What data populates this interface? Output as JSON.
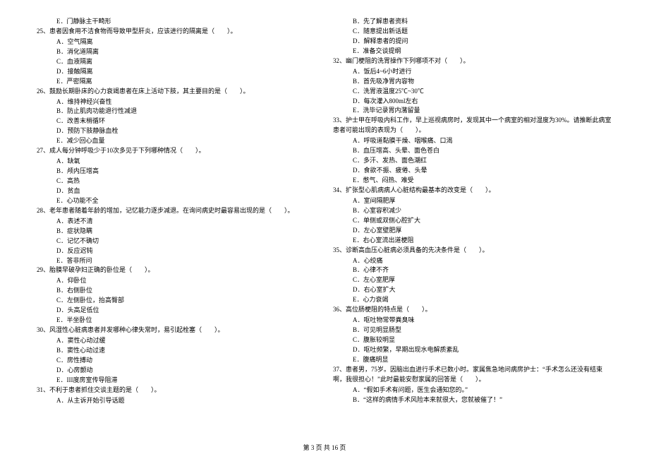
{
  "footer": "第 3 页 共 16 页",
  "left": {
    "preE": "E．门静脉主干畸形",
    "q25": {
      "stem": "25、患者因食用不洁食物而导致甲型肝炎，应该进行的隔离是（　　）。",
      "A": "A．空气隔离",
      "B": "B．消化道隔离",
      "C": "C．血液隔离",
      "D": "D．接触隔离",
      "E": "E．严密隔离"
    },
    "q26": {
      "stem": "26、鼓励长期卧床的心力衰竭患者在床上活动下肢，其主要目的是（　　）。",
      "A": "A．维持神经兴奋性",
      "B": "B．防止肌肉功能退行性减退",
      "C": "C．改善末梢循环",
      "D": "D．预防下肢静脉血栓",
      "E": "E．减少回心血量"
    },
    "q27": {
      "stem": "27、成人每分钟呼吸少于10次多见于下列哪种情况（　　）。",
      "A": "A．缺氧",
      "B": "B．颅内压增高",
      "C": "C．高热",
      "D": "D．贫血",
      "E": "E．心功能不全"
    },
    "q28": {
      "stem": "28、老年患者随着年龄的增加，记忆能力逐步减退。在询问病史时最容易出现的是（　　）。",
      "A": "A．表述不清",
      "B": "B．症状隐瞒",
      "C": "C．记忆不确切",
      "D": "D．反应迟钝",
      "E": "E．答非所问"
    },
    "q29": {
      "stem": "29、胎膜早破孕妇正确的卧位是（　　）。",
      "A": "A．仰卧位",
      "B": "B．右侧卧位",
      "C": "C．左侧卧位，抬高臀部",
      "D": "D．头高足低位",
      "E": "E．半坐卧位"
    },
    "q30": {
      "stem": "30、风湿性心脏病患者并发哪种心律失常时，易引起栓塞（　　）。",
      "A": "A．窦性心动过缓",
      "B": "B．窦性心动过速",
      "C": "C．房性搏动",
      "D": "D．心房颤动",
      "E": "E．III度房室传导阻滞"
    },
    "q31": {
      "stem": "31、不利于患者抓住交谈主题的是（　　）。",
      "A": "A．从主诉开始引导话题"
    }
  },
  "right": {
    "preB": "B．先了解患者资料",
    "preC": "C．随意提出新话题",
    "preD": "D．解释患者的提问",
    "preE": "E．准备交谈提纲",
    "q32": {
      "stem": "32、幽门梗阻的洗胃操作下列哪项不对（　　）。",
      "A": "A．饭后4~6小时进行",
      "B": "B．首先吸净胃内容物",
      "C": "C．洗胃液温度25℃~30℃",
      "D": "D．每次灌入800ml左右",
      "E": "E．洗毕记录胃内潴留量"
    },
    "q33": {
      "stem": "33、护士甲在呼吸内科工作，早上巡视病房时，发现其中一个病室的相对湿度为30%。请推断此病室患者可能出现的表现为（　　）。",
      "A": "A．呼吸道黏膜干燥、咽喉痛、口渴",
      "B": "B．血压增高、头晕、面色苍白",
      "C": "C．多汗、发热、面色潮红",
      "D": "D．食欲不振、疲倦、头晕",
      "E": "E．憋气、闷热、难受"
    },
    "q34": {
      "stem": "34、扩张型心肌病病人心脏结构最基本的改变是（　　）。",
      "A": "A．室间隔肥厚",
      "B": "B．心室容积减少",
      "C": "C．单侧或双侧心腔扩大",
      "D": "D．左心室壁肥厚",
      "E": "E．右心室流出道梗阻"
    },
    "q35": {
      "stem": "35、诊断高血压心脏病必须具备的先决条件是（　　）。",
      "A": "A．心绞痛",
      "B": "B．心律不齐",
      "C": "C．左心室肥厚",
      "D": "D．右心室扩大",
      "E": "E．心力衰竭"
    },
    "q36": {
      "stem": "36、高位肠梗阻的特点是（　　）。",
      "A": "A．呕吐物常带粪臭味",
      "B": "B．可见明显肠型",
      "C": "C．腹胀较明显",
      "D": "D．呕吐频繁，早期出现水电解质紊乱",
      "E": "E．腹痛明显"
    },
    "q37": {
      "stem": "37、患者男，75岁。因脑出血进行手术已数小时。家属焦急地问病房护士：“手术怎么还没有结束啊，我很担心！”此时最能安慰家属的回答是（　　）。",
      "A": "A．“假如手术有问题，医生会通知您的。”",
      "B": "B．“这样的病情手术风险本来就很大，您就被催了！”"
    }
  }
}
